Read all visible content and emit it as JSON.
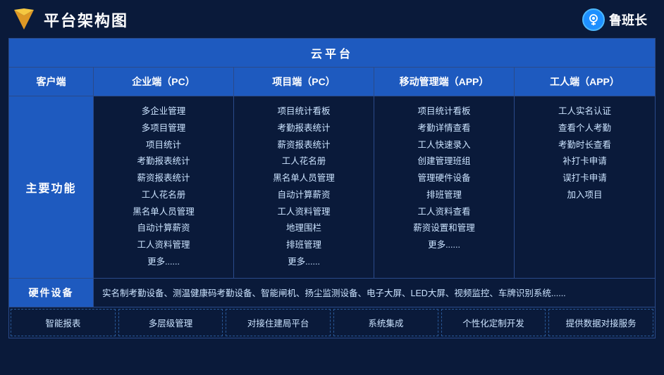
{
  "header": {
    "title": "平台架构图",
    "brand": "鲁班长"
  },
  "cloud_platform": "云平台",
  "columns": {
    "client": "客户端",
    "enterprise_pc": "企业端（PC）",
    "project_pc": "项目端（PC）",
    "mobile_app": "移动管理端（APP）",
    "worker_app": "工人端（APP）"
  },
  "main_function_label": "主要功能",
  "enterprise_features": [
    "多企业管理",
    "多项目管理",
    "项目统计",
    "考勤报表统计",
    "薪资报表统计",
    "工人花名册",
    "黑名单人员管理",
    "自动计算薪资",
    "工人资料管理",
    "更多......"
  ],
  "project_features": [
    "项目统计看板",
    "考勤报表统计",
    "薪资报表统计",
    "工人花名册",
    "黑名单人员管理",
    "自动计算薪资",
    "工人资料管理",
    "地理围栏",
    "排班管理",
    "更多......"
  ],
  "mobile_features": [
    "项目统计看板",
    "考勤详情查看",
    "工人快速录入",
    "创建管理班组",
    "管理硬件设备",
    "排班管理",
    "工人资料查看",
    "薪资设置和管理",
    "更多......"
  ],
  "worker_features": [
    "工人实名认证",
    "查看个人考勤",
    "考勤时长查看",
    "补打卡申请",
    "误打卡申请",
    "加入项目"
  ],
  "hardware_label": "硬件设备",
  "hardware_content": "实名制考勤设备、测温健康码考勤设备、智能闸机、扬尘监测设备、电子大屏、LED大屏、视频监控、车牌识别系统......",
  "bottom_features": [
    "智能报表",
    "多层级管理",
    "对接住建局平台",
    "系统集成",
    "个性化定制开发",
    "提供数据对接服务"
  ]
}
